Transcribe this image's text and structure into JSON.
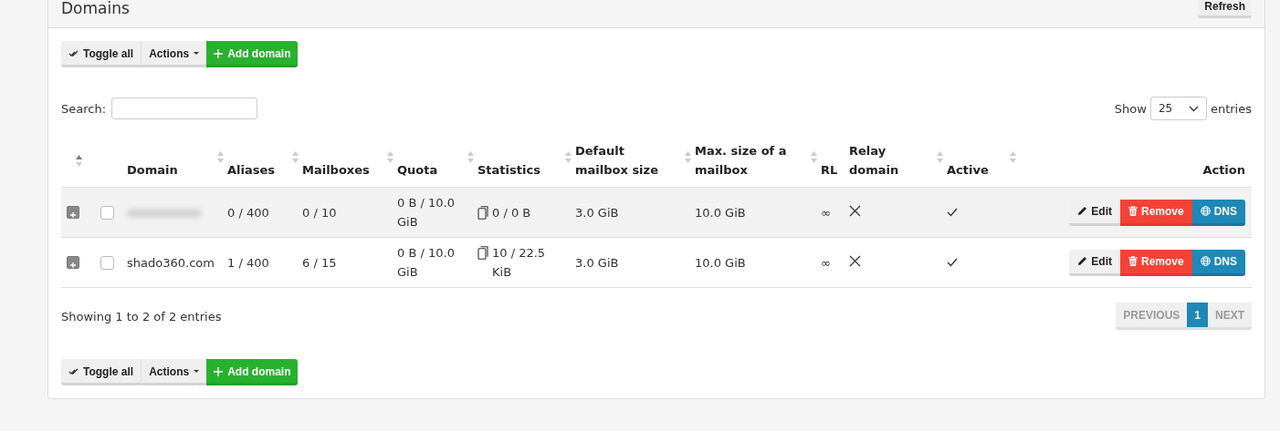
{
  "panel": {
    "title": "Domains",
    "refresh_button": "Refresh"
  },
  "toolbar_top": [
    {
      "kind": "toggle",
      "label": "Toggle all"
    },
    {
      "kind": "dropdown",
      "label": "Actions"
    },
    {
      "kind": "add",
      "label": "Add domain"
    }
  ],
  "search": {
    "label": "Search:"
  },
  "page_length": {
    "label_before": "Show",
    "value": "25",
    "label_after": "entries"
  },
  "table": {
    "columns": [
      {
        "sortable": true,
        "sorted": true
      },
      {
        "sortable": false
      },
      {
        "label": "Domain",
        "sortable": true,
        "sorted": false
      },
      {
        "label": "Aliases",
        "sortable": true,
        "sorted": false
      },
      {
        "label": "Mailboxes",
        "sortable": true,
        "sorted": false
      },
      {
        "label": "Quota",
        "sortable": true,
        "sorted": false
      },
      {
        "label": "Statistics",
        "sortable": true,
        "sorted": false
      },
      {
        "label": "Default mailbox size",
        "sortable": true,
        "sorted": false
      },
      {
        "label": "Max. size of a mailbox",
        "sortable": true,
        "sorted": false
      },
      {
        "label": "RL",
        "sortable": false
      },
      {
        "label": "Relay domain",
        "sortable": true,
        "sorted": false
      },
      {
        "label": "Active",
        "sortable": true,
        "sorted": false
      },
      {
        "label": "Action",
        "sortable": false
      }
    ],
    "rows": [
      {
        "hovered": true,
        "checked": false,
        "domain_blurred": true,
        "aliases": "0 / 400",
        "mailboxes": "0 / 10",
        "quota": "0 B / 10.0 GiB",
        "statistics": "0 / 0 B",
        "default_size": "3.0 GiB",
        "max_size": "10.0 GiB",
        "rl": "∞",
        "relay": false,
        "active": true,
        "actions": [
          {
            "kind": "edit",
            "label": "Edit"
          },
          {
            "kind": "remove",
            "label": "Remove"
          },
          {
            "kind": "dns",
            "label": "DNS"
          }
        ]
      },
      {
        "hovered": false,
        "checked": false,
        "domain": "shado360.com",
        "domain_blurred": false,
        "aliases": "1 / 400",
        "mailboxes": "6 / 15",
        "quota": "0 B / 10.0 GiB",
        "statistics": "10 / 22.5 KiB",
        "default_size": "3.0 GiB",
        "max_size": "10.0 GiB",
        "rl": "∞",
        "relay": false,
        "active": true,
        "actions": [
          {
            "kind": "edit",
            "label": "Edit"
          },
          {
            "kind": "remove",
            "label": "Remove"
          },
          {
            "kind": "dns",
            "label": "DNS"
          }
        ]
      }
    ]
  },
  "info": "Showing 1 to 2 of 2 entries",
  "pagination": [
    {
      "label": "PREVIOUS",
      "selected": false,
      "disabled": true
    },
    {
      "label": "1",
      "selected": true,
      "disabled": false
    },
    {
      "label": "NEXT",
      "selected": false,
      "disabled": true
    }
  ],
  "toolbar_bottom": [
    {
      "kind": "toggle",
      "label": "Toggle all"
    },
    {
      "kind": "dropdown",
      "label": "Actions"
    },
    {
      "kind": "add",
      "label": "Add domain"
    }
  ]
}
